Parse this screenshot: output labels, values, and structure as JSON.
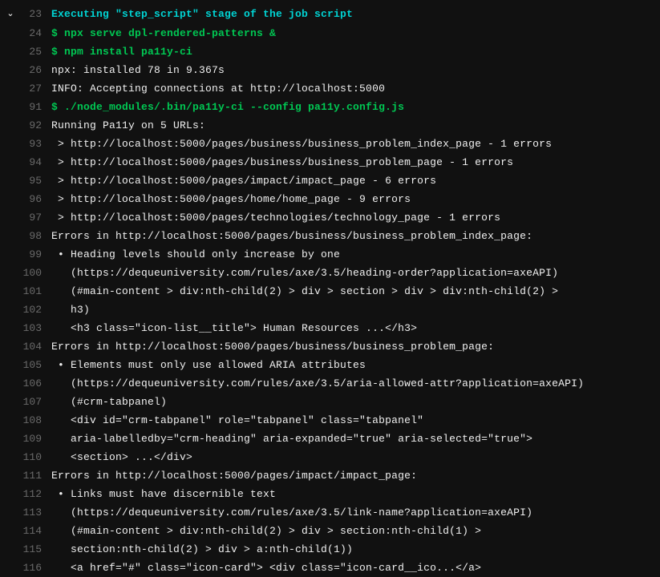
{
  "lines": [
    {
      "num": "23",
      "collapse": true,
      "cls": "text-cyan",
      "text": "Executing \"step_script\" stage of the job script"
    },
    {
      "num": "24",
      "cls": "text-green",
      "text": "$ npx serve dpl-rendered-patterns &"
    },
    {
      "num": "25",
      "cls": "text-green",
      "text": "$ npm install pa11y-ci"
    },
    {
      "num": "26",
      "cls": "text-white",
      "text": "npx: installed 78 in 9.367s"
    },
    {
      "num": "27",
      "cls": "text-white",
      "text": "INFO: Accepting connections at http://localhost:5000"
    },
    {
      "num": "91",
      "cls": "text-green",
      "text": "$ ./node_modules/.bin/pa11y-ci --config pa11y.config.js"
    },
    {
      "num": "92",
      "cls": "text-white",
      "text": "Running Pa11y on 5 URLs:"
    },
    {
      "num": "93",
      "cls": "text-white",
      "text": " > http://localhost:5000/pages/business/business_problem_index_page - 1 errors"
    },
    {
      "num": "94",
      "cls": "text-white",
      "text": " > http://localhost:5000/pages/business/business_problem_page - 1 errors"
    },
    {
      "num": "95",
      "cls": "text-white",
      "text": " > http://localhost:5000/pages/impact/impact_page - 6 errors"
    },
    {
      "num": "96",
      "cls": "text-white",
      "text": " > http://localhost:5000/pages/home/home_page - 9 errors"
    },
    {
      "num": "97",
      "cls": "text-white",
      "text": " > http://localhost:5000/pages/technologies/technology_page - 1 errors"
    },
    {
      "num": "98",
      "cls": "text-white",
      "text": "Errors in http://localhost:5000/pages/business/business_problem_index_page:"
    },
    {
      "num": "99",
      "cls": "text-white",
      "text": " • Heading levels should only increase by one"
    },
    {
      "num": "100",
      "cls": "text-white",
      "text": "   (https://dequeuniversity.com/rules/axe/3.5/heading-order?application=axeAPI)"
    },
    {
      "num": "101",
      "cls": "text-white",
      "text": "   (#main-content > div:nth-child(2) > div > section > div > div:nth-child(2) >"
    },
    {
      "num": "102",
      "cls": "text-white",
      "text": "   h3)"
    },
    {
      "num": "103",
      "cls": "text-white",
      "text": "   <h3 class=\"icon-list__title\"> Human Resources ...</h3>"
    },
    {
      "num": "104",
      "cls": "text-white",
      "text": "Errors in http://localhost:5000/pages/business/business_problem_page:"
    },
    {
      "num": "105",
      "cls": "text-white",
      "text": " • Elements must only use allowed ARIA attributes"
    },
    {
      "num": "106",
      "cls": "text-white",
      "text": "   (https://dequeuniversity.com/rules/axe/3.5/aria-allowed-attr?application=axeAPI)"
    },
    {
      "num": "107",
      "cls": "text-white",
      "text": "   (#crm-tabpanel)"
    },
    {
      "num": "108",
      "cls": "text-white",
      "text": "   <div id=\"crm-tabpanel\" role=\"tabpanel\" class=\"tabpanel\""
    },
    {
      "num": "109",
      "cls": "text-white",
      "text": "   aria-labelledby=\"crm-heading\" aria-expanded=\"true\" aria-selected=\"true\">"
    },
    {
      "num": "110",
      "cls": "text-white",
      "text": "   <section> ...</div>"
    },
    {
      "num": "111",
      "cls": "text-white",
      "text": "Errors in http://localhost:5000/pages/impact/impact_page:"
    },
    {
      "num": "112",
      "cls": "text-white",
      "text": " • Links must have discernible text"
    },
    {
      "num": "113",
      "cls": "text-white",
      "text": "   (https://dequeuniversity.com/rules/axe/3.5/link-name?application=axeAPI)"
    },
    {
      "num": "114",
      "cls": "text-white",
      "text": "   (#main-content > div:nth-child(2) > div > section:nth-child(1) >"
    },
    {
      "num": "115",
      "cls": "text-white",
      "text": "   section:nth-child(2) > div > a:nth-child(1))"
    },
    {
      "num": "116",
      "cls": "text-white",
      "text": "   <a href=\"#\" class=\"icon-card\"> <div class=\"icon-card__ico...</a>"
    }
  ]
}
